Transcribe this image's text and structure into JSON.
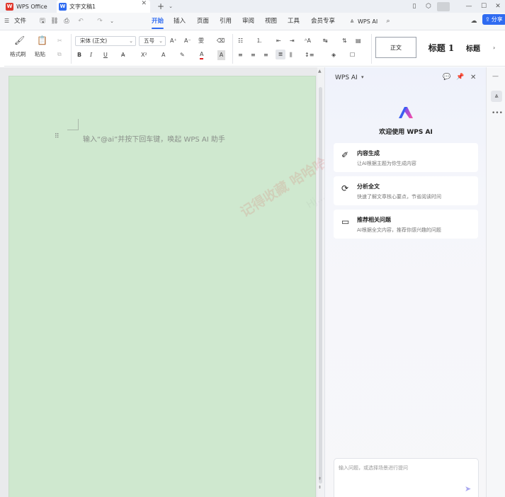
{
  "tabs": {
    "home": "WPS Office",
    "doc": "文字文稿1",
    "add": "+"
  },
  "menu": {
    "file": "文件",
    "items": [
      "开始",
      "插入",
      "页面",
      "引用",
      "审阅",
      "视图",
      "工具",
      "会员专享"
    ],
    "ai": "WPS AI",
    "share": "分享"
  },
  "ribbon": {
    "format_painter": "格式刷",
    "paste": "粘贴",
    "font_name": "宋体 (正文)",
    "font_size": "五号",
    "styles": [
      "正文",
      "标题 1",
      "标题"
    ]
  },
  "document": {
    "placeholder": "输入“@ai”并按下回车键，唤起 WPS AI 助手"
  },
  "ai_panel": {
    "title": "WPS AI",
    "welcome": "欢迎使用 WPS AI",
    "cards": [
      {
        "title": "内容生成",
        "desc": "让AI根据主题为你生成内容"
      },
      {
        "title": "分析全文",
        "desc": "快速了解文章核心要点，节省阅读时间"
      },
      {
        "title": "推荐相关问题",
        "desc": "AI根据全文内容，推荐你感兴趣的问题"
      }
    ],
    "input_placeholder": "输入问题，或选择场景进行提问"
  },
  "watermark": {
    "text1": "记得收藏  哈哈哈",
    "text2": "Hj...com"
  },
  "colors": {
    "accent": "#2f6bf1",
    "page_bg": "#cfe8cf",
    "wps_red": "#e0362c"
  }
}
